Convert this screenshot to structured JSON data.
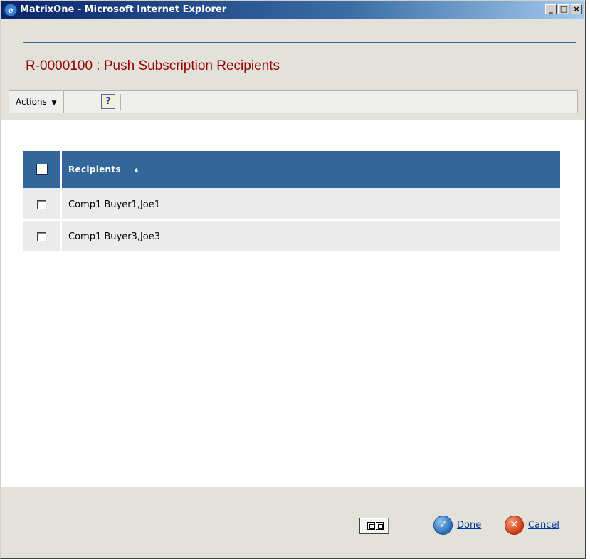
{
  "window": {
    "title": "MatrixOne - Microsoft Internet Explorer",
    "controls": [
      "_",
      "□",
      "×"
    ]
  },
  "page": {
    "title": "R-0000100 : Push Subscription Recipients"
  },
  "toolbar": {
    "actions_label": "Actions",
    "actions_caret": "▼",
    "help_label": "?"
  },
  "table": {
    "header": "Recipients",
    "sort_indicator": "▲",
    "rows": [
      {
        "label": "Comp1 Buyer1,Joe1"
      },
      {
        "label": "Comp1 Buyer3,Joe3"
      }
    ]
  },
  "footer": {
    "done_label": "Done",
    "cancel_label": "Cancel",
    "done_icon": "check-icon",
    "cancel_icon": "x-icon"
  },
  "colors": {
    "title_red": "#990000",
    "header_blue": "#336699",
    "link_blue": "#00339a"
  }
}
